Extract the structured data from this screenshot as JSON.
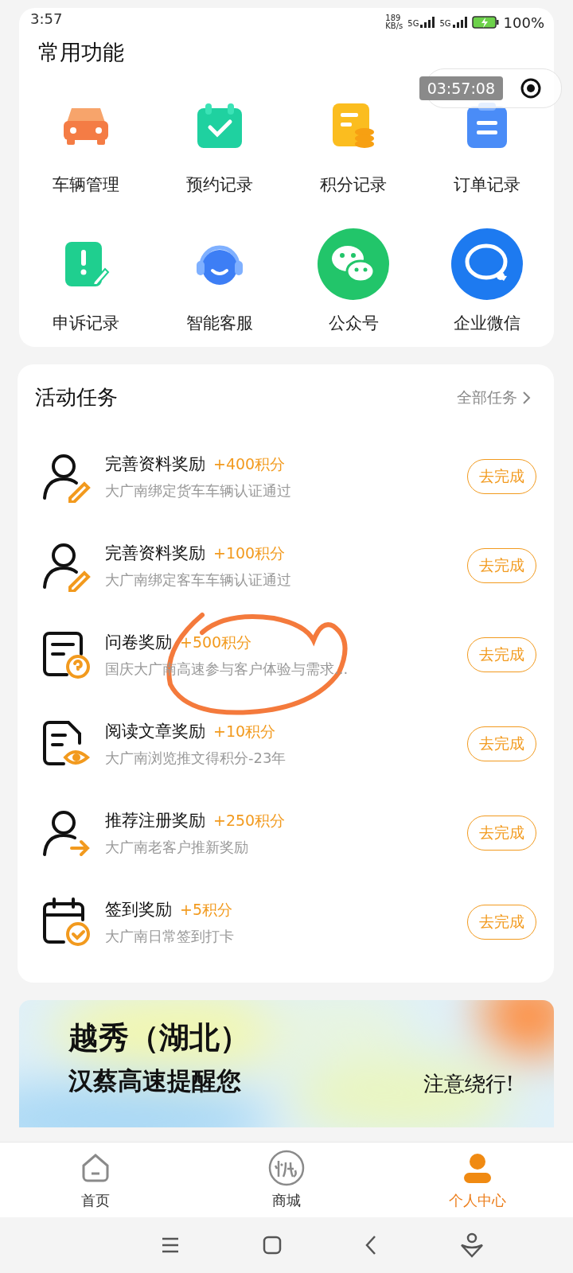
{
  "status_bar": {
    "time": "3:57",
    "speed_value": "189",
    "speed_unit": "KB/s",
    "network_1": "5G",
    "network_2": "5G",
    "battery": "100%"
  },
  "recorder": {
    "timer": "03:57:08"
  },
  "functions": {
    "title": "常用功能",
    "items": [
      {
        "label": "车辆管理",
        "kind": "car"
      },
      {
        "label": "预约记录",
        "kind": "calendar"
      },
      {
        "label": "积分记录",
        "kind": "coins"
      },
      {
        "label": "订单记录",
        "kind": "clipboard"
      },
      {
        "label": "申诉记录",
        "kind": "complaint"
      },
      {
        "label": "智能客服",
        "kind": "headset"
      },
      {
        "label": "公众号",
        "kind": "chat"
      },
      {
        "label": "企业微信",
        "kind": "workchat"
      }
    ]
  },
  "tasks": {
    "title": "活动任务",
    "more": "全部任务",
    "items": [
      {
        "title": "完善资料奖励",
        "points": "+400积分",
        "desc": "大广南绑定货车车辆认证通过",
        "kind": "profile",
        "button": "去完成"
      },
      {
        "title": "完善资料奖励",
        "points": "+100积分",
        "desc": "大广南绑定客车车辆认证通过",
        "kind": "profile",
        "button": "去完成"
      },
      {
        "title": "问卷奖励",
        "points": "+500积分",
        "desc": "国庆大广南高速参与客户体验与需求...",
        "kind": "survey",
        "button": "去完成"
      },
      {
        "title": "阅读文章奖励",
        "points": "+10积分",
        "desc": "大广南浏览推文得积分-23年",
        "kind": "read",
        "button": "去完成"
      },
      {
        "title": "推荐注册奖励",
        "points": "+250积分",
        "desc": "大广南老客户推新奖励",
        "kind": "refer",
        "button": "去完成"
      },
      {
        "title": "签到奖励",
        "points": "+5积分",
        "desc": "大广南日常签到打卡",
        "kind": "checkin",
        "button": "去完成"
      }
    ]
  },
  "banner": {
    "line_1": "越秀（湖北）",
    "line_2": "汉蔡高速提醒您",
    "line_3": "注意绕行!"
  },
  "tabs": [
    {
      "label": "首页",
      "kind": "home",
      "selected": false
    },
    {
      "label": "商城",
      "kind": "mall",
      "selected": false
    },
    {
      "label": "个人中心",
      "kind": "profile",
      "selected": true
    }
  ]
}
